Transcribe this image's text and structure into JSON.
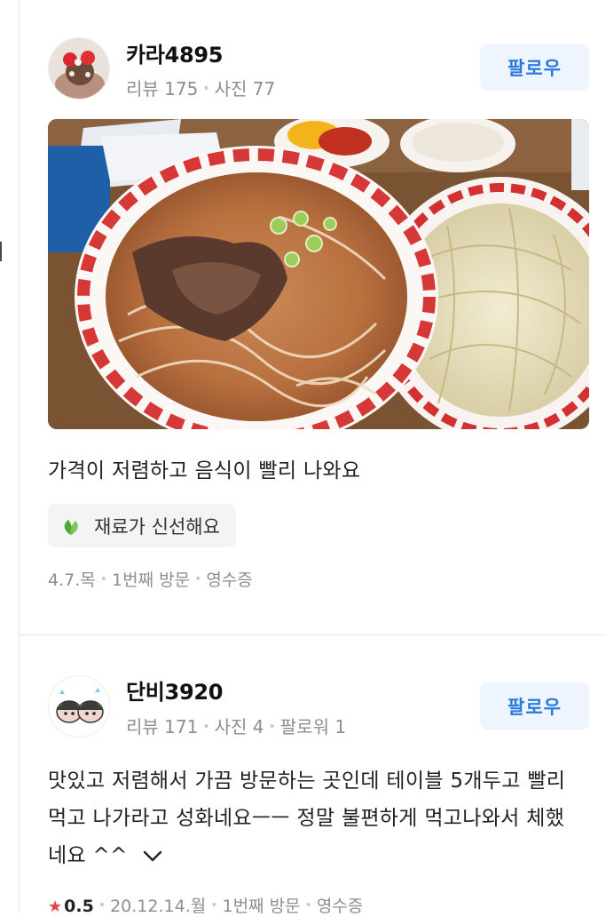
{
  "reviews": [
    {
      "author": "카라4895",
      "stats": [
        "리뷰 175",
        "사진 77"
      ],
      "follow_label": "팔로우",
      "text": "가격이 저렴하고 음식이 빨리 나와요",
      "tag": "재료가 신선해요",
      "footer": [
        "4.7.목",
        "1번째 방문",
        "영수증"
      ]
    },
    {
      "author": "단비3920",
      "stats": [
        "리뷰 171",
        "사진 4",
        "팔로워 1"
      ],
      "follow_label": "팔로우",
      "text": "맛있고 저렴해서 가끔 방문하는 곳인데 테이블 5개두고 빨리 먹고 나가라고 성화네요ㅡㅡ 정말 불편하게 먹고나와서 체했네요 ^^",
      "rating": "0.5",
      "footer": [
        "20.12.14.월",
        "1번째 방문",
        "영수증"
      ]
    }
  ],
  "colors": {
    "follow_text": "#2a7bdd",
    "follow_bg": "#eef5fe",
    "star": "#e8423b",
    "meta": "#8e8e8e"
  },
  "icons": [
    "leaf-icon",
    "chevron-down-icon",
    "star-icon"
  ]
}
